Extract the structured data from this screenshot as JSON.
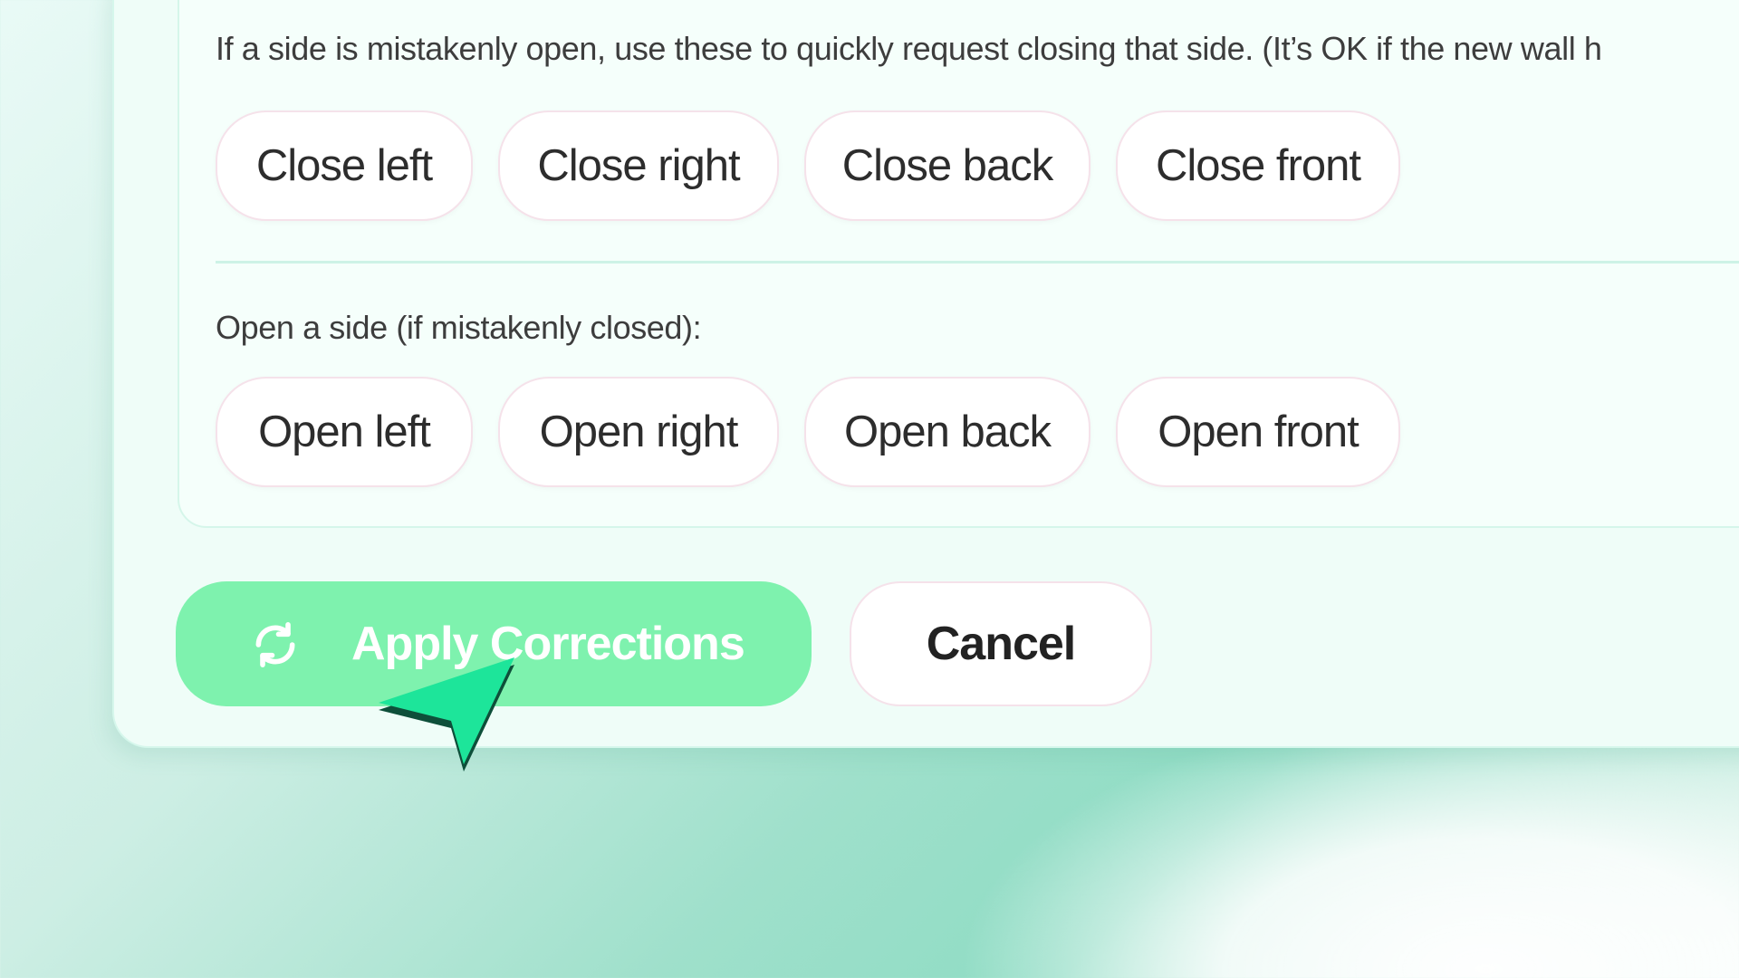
{
  "corrections": {
    "close_note": "If a side is mistakenly open, use these to quickly request closing that side. (It’s OK if the new wall h",
    "close_buttons": [
      "Close left",
      "Close right",
      "Close back",
      "Close front"
    ],
    "open_heading": "Open a side (if mistakenly closed):",
    "open_buttons": [
      "Open left",
      "Open right",
      "Open back",
      "Open front"
    ]
  },
  "actions": {
    "apply_label": "Apply Corrections",
    "apply_icon": "refresh-icon",
    "cancel_label": "Cancel"
  },
  "colors": {
    "accent": "#7ef2ae",
    "cursor": "#1de59a"
  }
}
